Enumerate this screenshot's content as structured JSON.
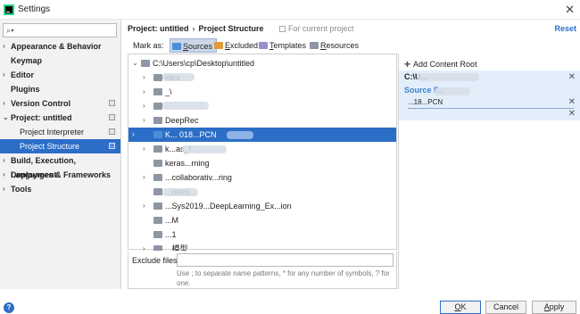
{
  "window": {
    "title": "Settings"
  },
  "search": {
    "placeholder": ""
  },
  "sidebar": {
    "items": [
      {
        "label": "Appearance & Behavior"
      },
      {
        "label": "Keymap"
      },
      {
        "label": "Editor"
      },
      {
        "label": "Plugins"
      },
      {
        "label": "Version Control"
      },
      {
        "label": "Project: untitled"
      },
      {
        "label": "Project Interpreter"
      },
      {
        "label": "Project Structure"
      },
      {
        "label": "Build, Execution, Deployment"
      },
      {
        "label": "Languages & Frameworks"
      },
      {
        "label": "Tools"
      }
    ]
  },
  "header": {
    "project": "Project: untitled",
    "separator": "›",
    "page": "Project Structure",
    "for_current": "For current project",
    "reset": "Reset"
  },
  "markas": {
    "label": "Mark as:",
    "buttons": [
      {
        "key": "S",
        "rest": "ources",
        "color": "#4a8fd8"
      },
      {
        "key": "E",
        "rest": "xcluded",
        "color": "#e39a3b"
      },
      {
        "key": "T",
        "rest": "emplates",
        "color": "#9c8fd0"
      },
      {
        "key": "R",
        "rest": "esources",
        "color": "#8d96a3"
      }
    ]
  },
  "tree": {
    "root": "C:\\Users\\cp\\Desktop\\untitled",
    "rows": [
      {
        "label": "idea"
      },
      {
        "label": "_\\"
      },
      {
        "label": ""
      },
      {
        "label": "DeepRec"
      },
      {
        "label": "K... 018...PCN"
      },
      {
        "label": "k...as_f..."
      },
      {
        "label": "keras...rning"
      },
      {
        "label": "...collaborativ...ring"
      },
      {
        "label": "...ritani..."
      },
      {
        "label": "...Sys2019...DeepLearning_Ex...ion"
      },
      {
        "label": "...M"
      },
      {
        "label": "...1"
      },
      {
        "label": "...模型"
      }
    ]
  },
  "exclude": {
    "label": "Exclude files:",
    "value": "",
    "hint": "Use ; to separate name patterns, * for any number of symbols, ? for one."
  },
  "right": {
    "add_root": "Add Content Root",
    "root_path": "C:\\U...",
    "source_title": "Source F...",
    "source_entry": "...18...PCN"
  },
  "buttons": {
    "ok_key": "O",
    "ok_rest": "K",
    "cancel": "Cancel",
    "apply_key": "A",
    "apply_rest": "pply",
    "help": "?"
  },
  "colors": {
    "accent": "#2c6ec7"
  }
}
